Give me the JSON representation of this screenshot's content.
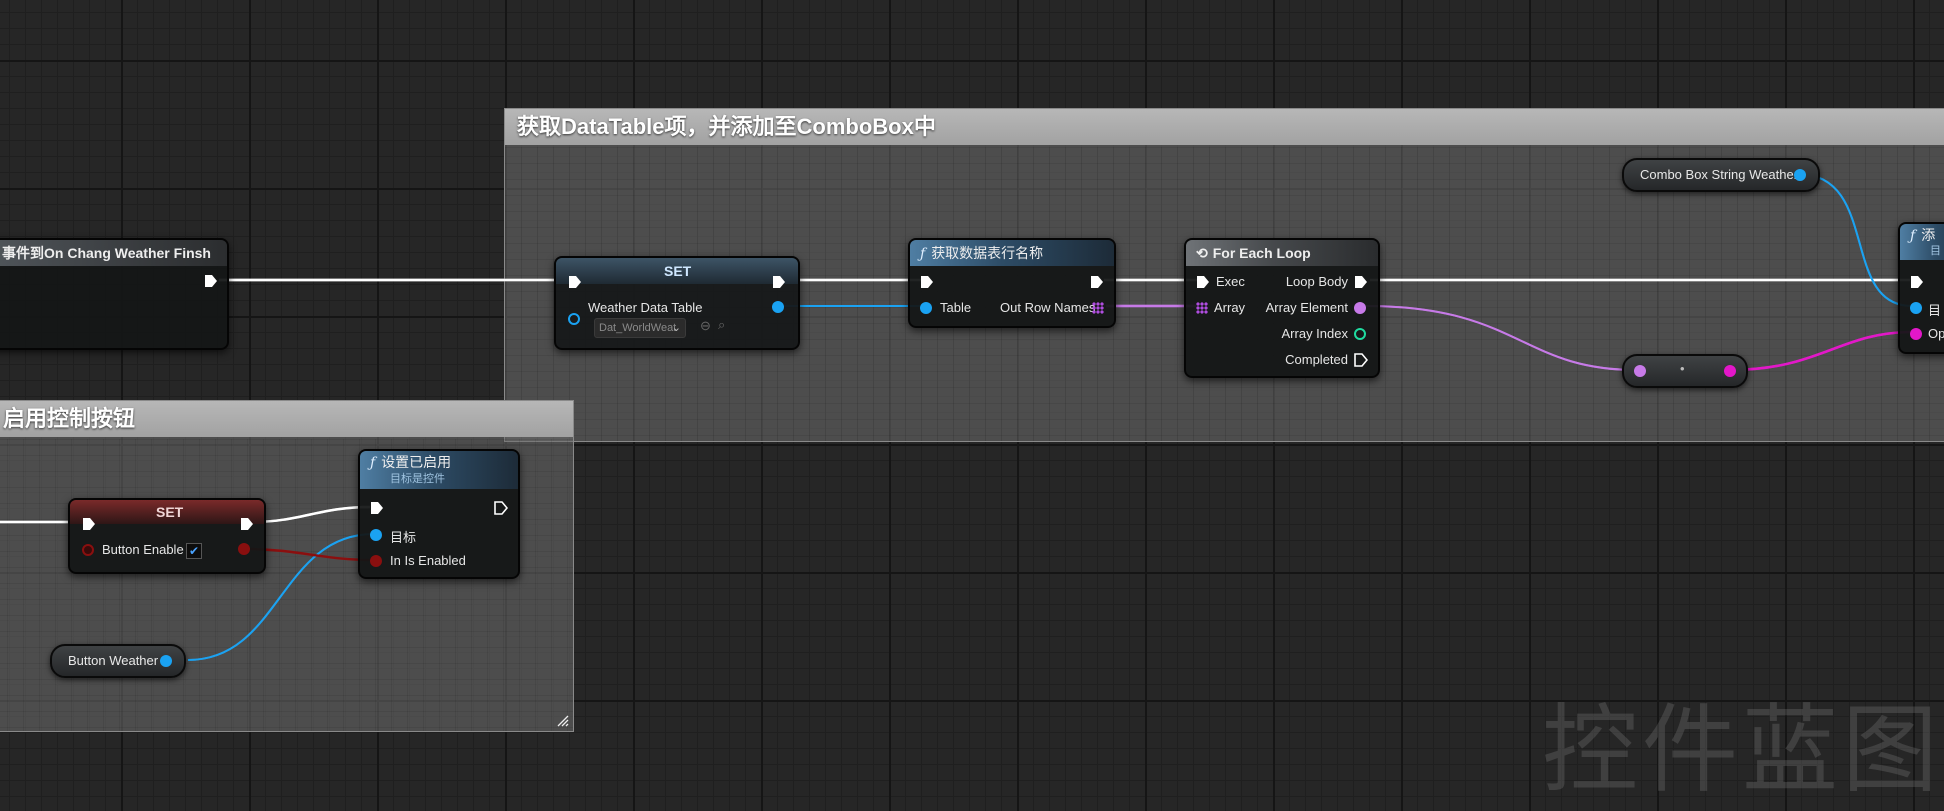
{
  "comments": {
    "top_title": "获取DataTable项，并添加至ComboBox中",
    "bottom_title": "启用控制按钮"
  },
  "event_node": {
    "title": "事件到On Chang Weather Finsh"
  },
  "set_node_top": {
    "title": "SET",
    "pin_label": "Weather Data Table",
    "dropdown_value": "Dat_WorldWeat"
  },
  "get_row_names_node": {
    "title": "获取数据表行名称",
    "in_table": "Table",
    "out_row_names": "Out Row Names"
  },
  "for_each_node": {
    "title": "For Each Loop",
    "exec": "Exec",
    "loop_body": "Loop Body",
    "array": "Array",
    "array_element": "Array Element",
    "array_index": "Array Index",
    "completed": "Completed"
  },
  "combo_var": {
    "label": "Combo Box String Weather"
  },
  "add_option_node": {
    "title": "添",
    "sub": "目",
    "pin_target": "目",
    "pin_option": "Op"
  },
  "set_node_bottom": {
    "title": "SET",
    "pin_label": "Button Enable"
  },
  "set_enabled_node": {
    "title": "设置已启用",
    "subtitle": "目标是控件",
    "pin_target": "目标",
    "pin_enabled": "In Is Enabled"
  },
  "button_var": {
    "label": "Button Weather"
  },
  "watermark": "控件蓝图",
  "colors": {
    "object_pin": "#1aa2f2",
    "name_pin": "#c77ae8",
    "string_pin": "#e317c9",
    "bool_pin": "#8a0f0f",
    "int_pin": "#1fdba0",
    "exec_wire": "#ffffff"
  }
}
